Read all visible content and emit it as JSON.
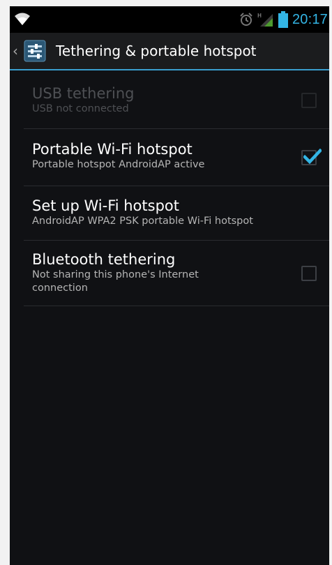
{
  "status_bar": {
    "time": "20:17",
    "accent_color": "#33b5e5",
    "icons": [
      "wifi-icon",
      "alarm-icon",
      "signal-icon",
      "battery-icon"
    ]
  },
  "action_bar": {
    "title": "Tethering & portable hotspot",
    "icon": "settings-sliders-icon"
  },
  "items": [
    {
      "title": "USB tethering",
      "subtitle": "USB not connected",
      "enabled": false,
      "checked": false
    },
    {
      "title": "Portable Wi-Fi hotspot",
      "subtitle": "Portable hotspot AndroidAP active",
      "enabled": true,
      "checked": true
    },
    {
      "title": "Set up Wi-Fi hotspot",
      "subtitle": "AndroidAP WPA2 PSK portable Wi-Fi hotspot",
      "enabled": true
    },
    {
      "title": "Bluetooth tethering",
      "subtitle": "Not sharing this phone's Internet connection",
      "enabled": true,
      "checked": false
    }
  ]
}
